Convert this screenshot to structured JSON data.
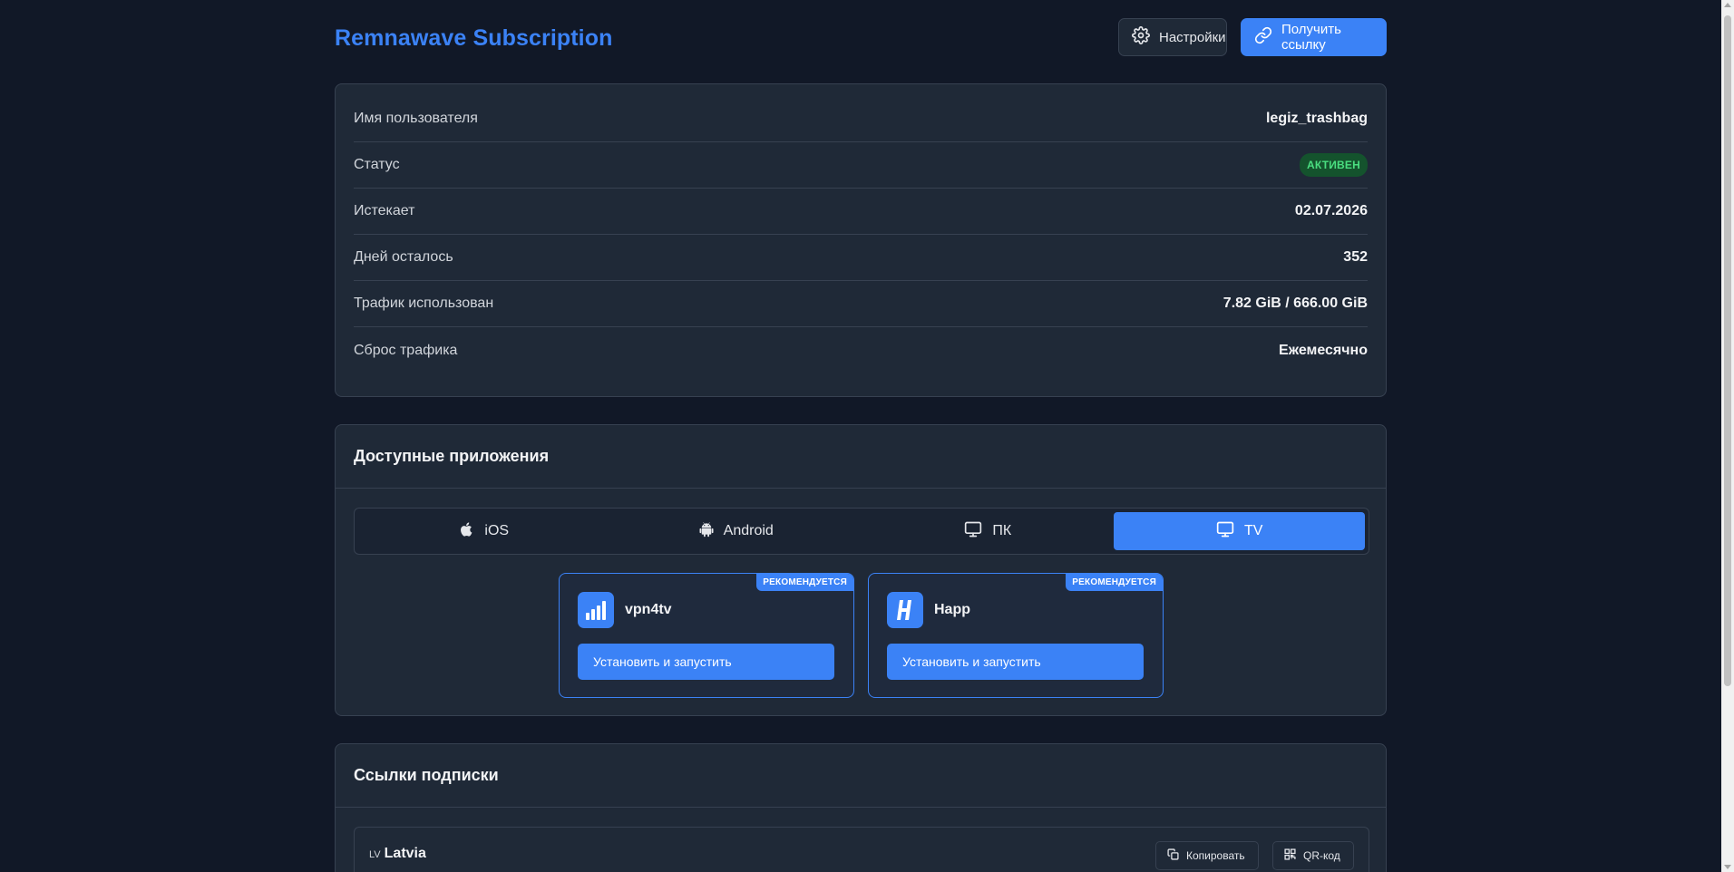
{
  "header": {
    "brand": "Remnawave Subscription",
    "settings_label": "Настройки",
    "get_link_label": "Получить ссылку"
  },
  "info": {
    "rows": [
      {
        "label": "Имя пользователя",
        "value": "legiz_trashbag"
      },
      {
        "label": "Статус",
        "value": "АКТИВЕН"
      },
      {
        "label": "Истекает",
        "value": "02.07.2026"
      },
      {
        "label": "Дней осталось",
        "value": "352"
      },
      {
        "label": "Трафик использован",
        "value": "7.82 GiB / 666.00 GiB"
      },
      {
        "label": "Сброс трафика",
        "value": "Ежемесячно"
      }
    ]
  },
  "apps": {
    "title": "Доступные приложения",
    "tabs": [
      {
        "label": "iOS",
        "icon": "apple-icon"
      },
      {
        "label": "Android",
        "icon": "android-icon"
      },
      {
        "label": "ПК",
        "icon": "monitor-icon"
      },
      {
        "label": "TV",
        "icon": "tv-icon",
        "active": true
      }
    ],
    "cards": [
      {
        "name": "vpn4tv",
        "badge": "РЕКОМЕНДУЕТСЯ",
        "button": "Установить и запустить",
        "icon": "signal-bars-icon"
      },
      {
        "name": "Happ",
        "badge": "РЕКОМЕНДУЕТСЯ",
        "button": "Установить и запустить",
        "icon": "happ-logo-icon"
      }
    ]
  },
  "links": {
    "title": "Ссылки подписки",
    "items": [
      {
        "code": "LV",
        "name": "Latvia",
        "copy_label": "Копировать",
        "qr_label": "QR-код"
      }
    ]
  },
  "colors": {
    "background": "#111827",
    "card": "#1f2937",
    "accent": "#3b82f6",
    "active_badge_bg": "#14532d",
    "active_badge_fg": "#4ade80"
  }
}
